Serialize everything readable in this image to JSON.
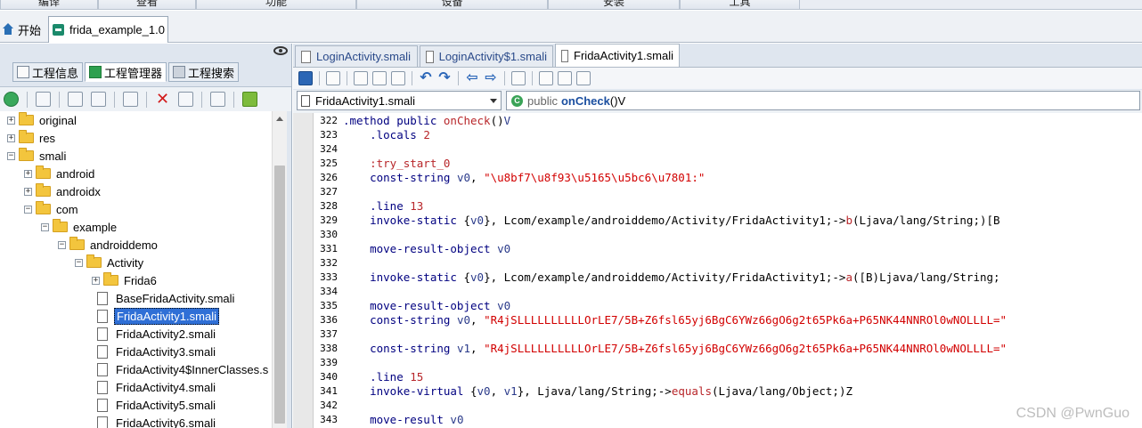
{
  "menubar": {
    "items": [
      {
        "label": "编译"
      },
      {
        "label": "查看"
      },
      {
        "label": "功能"
      },
      {
        "label": "设备"
      },
      {
        "label": "安装"
      },
      {
        "label": "工具"
      }
    ]
  },
  "doctabs": {
    "start_label": "开始",
    "project_label": "frida_example_1.0"
  },
  "left_panel": {
    "tabs": [
      {
        "label": "工程信息"
      },
      {
        "label": "工程管理器"
      },
      {
        "label": "工程搜索"
      }
    ],
    "tree": [
      {
        "label": "original",
        "kind": "folder",
        "depth": 0,
        "expand": "+"
      },
      {
        "label": "res",
        "kind": "folder",
        "depth": 0,
        "expand": "+"
      },
      {
        "label": "smali",
        "kind": "folder",
        "depth": 0,
        "expand": "-"
      },
      {
        "label": "android",
        "kind": "folder",
        "depth": 1,
        "expand": "+"
      },
      {
        "label": "androidx",
        "kind": "folder",
        "depth": 1,
        "expand": "+"
      },
      {
        "label": "com",
        "kind": "folder",
        "depth": 1,
        "expand": "-"
      },
      {
        "label": "example",
        "kind": "folder",
        "depth": 2,
        "expand": "-"
      },
      {
        "label": "androiddemo",
        "kind": "folder",
        "depth": 3,
        "expand": "-"
      },
      {
        "label": "Activity",
        "kind": "folder",
        "depth": 4,
        "expand": "-"
      },
      {
        "label": "Frida6",
        "kind": "folder",
        "depth": 5,
        "expand": "+"
      },
      {
        "label": "BaseFridaActivity.smali",
        "kind": "file",
        "depth": 5
      },
      {
        "label": "FridaActivity1.smali",
        "kind": "file",
        "depth": 5,
        "selected": true
      },
      {
        "label": "FridaActivity2.smali",
        "kind": "file",
        "depth": 5
      },
      {
        "label": "FridaActivity3.smali",
        "kind": "file",
        "depth": 5
      },
      {
        "label": "FridaActivity4$InnerClasses.s",
        "kind": "file",
        "depth": 5
      },
      {
        "label": "FridaActivity4.smali",
        "kind": "file",
        "depth": 5
      },
      {
        "label": "FridaActivity5.smali",
        "kind": "file",
        "depth": 5
      },
      {
        "label": "FridaActivity6.smali",
        "kind": "file",
        "depth": 5
      }
    ]
  },
  "editor": {
    "tabs": [
      {
        "label": "LoginActivity.smali"
      },
      {
        "label": "LoginActivity$1.smali"
      },
      {
        "label": "FridaActivity1.smali",
        "active": true
      }
    ],
    "class_selector": "FridaActivity1.smali",
    "method_selector": {
      "modifier": "public",
      "name": "onCheck",
      "signature": "()V"
    },
    "lines": [
      {
        "n": "322",
        "parts": [
          [
            "kwd",
            ".method public "
          ],
          [
            "lab",
            "onCheck"
          ],
          [
            "norm",
            "()"
          ],
          [
            "reg",
            "V"
          ]
        ]
      },
      {
        "n": "323",
        "parts": [
          [
            "kwd",
            "    .locals "
          ],
          [
            "lab",
            "2"
          ]
        ]
      },
      {
        "n": "324",
        "parts": []
      },
      {
        "n": "325",
        "parts": [
          [
            "lab",
            "    :try_start_0"
          ]
        ]
      },
      {
        "n": "326",
        "parts": [
          [
            "kwd",
            "    const-string "
          ],
          [
            "reg",
            "v0"
          ],
          [
            "norm",
            ", "
          ],
          [
            "str",
            "\"\\u8bf7\\u8f93\\u5165\\u5bc6\\u7801:\""
          ]
        ]
      },
      {
        "n": "327",
        "parts": []
      },
      {
        "n": "328",
        "parts": [
          [
            "kwd",
            "    .line "
          ],
          [
            "lab",
            "13"
          ]
        ]
      },
      {
        "n": "329",
        "parts": [
          [
            "kwd",
            "    invoke-static "
          ],
          [
            "norm",
            "{"
          ],
          [
            "reg",
            "v0"
          ],
          [
            "norm",
            "}, Lcom/example/androiddemo/Activity/FridaActivity1;->"
          ],
          [
            "lab",
            "b"
          ],
          [
            "norm",
            "(Ljava/lang/String;)[B"
          ]
        ]
      },
      {
        "n": "330",
        "parts": []
      },
      {
        "n": "331",
        "parts": [
          [
            "kwd",
            "    move-result-object "
          ],
          [
            "reg",
            "v0"
          ]
        ]
      },
      {
        "n": "332",
        "parts": []
      },
      {
        "n": "333",
        "parts": [
          [
            "kwd",
            "    invoke-static "
          ],
          [
            "norm",
            "{"
          ],
          [
            "reg",
            "v0"
          ],
          [
            "norm",
            "}, Lcom/example/androiddemo/Activity/FridaActivity1;->"
          ],
          [
            "lab",
            "a"
          ],
          [
            "norm",
            "([B)Ljava/lang/String;"
          ]
        ]
      },
      {
        "n": "334",
        "parts": []
      },
      {
        "n": "335",
        "parts": [
          [
            "kwd",
            "    move-result-object "
          ],
          [
            "reg",
            "v0"
          ]
        ]
      },
      {
        "n": "336",
        "parts": [
          [
            "kwd",
            "    const-string "
          ],
          [
            "reg",
            "v0"
          ],
          [
            "norm",
            ", "
          ],
          [
            "str",
            "\"R4jSLLLLLLLLLLOrLE7/5B+Z6fsl65yj6BgC6YWz66gO6g2t65Pk6a+P65NK44NNROl0wNOLLLL=\""
          ]
        ]
      },
      {
        "n": "337",
        "parts": []
      },
      {
        "n": "338",
        "parts": [
          [
            "kwd",
            "    const-string "
          ],
          [
            "reg",
            "v1"
          ],
          [
            "norm",
            ", "
          ],
          [
            "str",
            "\"R4jSLLLLLLLLLLOrLE7/5B+Z6fsl65yj6BgC6YWz66gO6g2t65Pk6a+P65NK44NNROl0wNOLLLL=\""
          ]
        ]
      },
      {
        "n": "339",
        "parts": []
      },
      {
        "n": "340",
        "parts": [
          [
            "kwd",
            "    .line "
          ],
          [
            "lab",
            "15"
          ]
        ]
      },
      {
        "n": "341",
        "parts": [
          [
            "kwd",
            "    invoke-virtual "
          ],
          [
            "norm",
            "{"
          ],
          [
            "reg",
            "v0"
          ],
          [
            "norm",
            ", "
          ],
          [
            "reg",
            "v1"
          ],
          [
            "norm",
            "}, Ljava/lang/String;->"
          ],
          [
            "lab",
            "equals"
          ],
          [
            "norm",
            "(Ljava/lang/Object;)Z"
          ]
        ]
      },
      {
        "n": "342",
        "parts": []
      },
      {
        "n": "343",
        "parts": [
          [
            "kwd",
            "    move-result "
          ],
          [
            "reg",
            "v0"
          ]
        ]
      }
    ]
  },
  "watermark": "CSDN @PwnGuo"
}
